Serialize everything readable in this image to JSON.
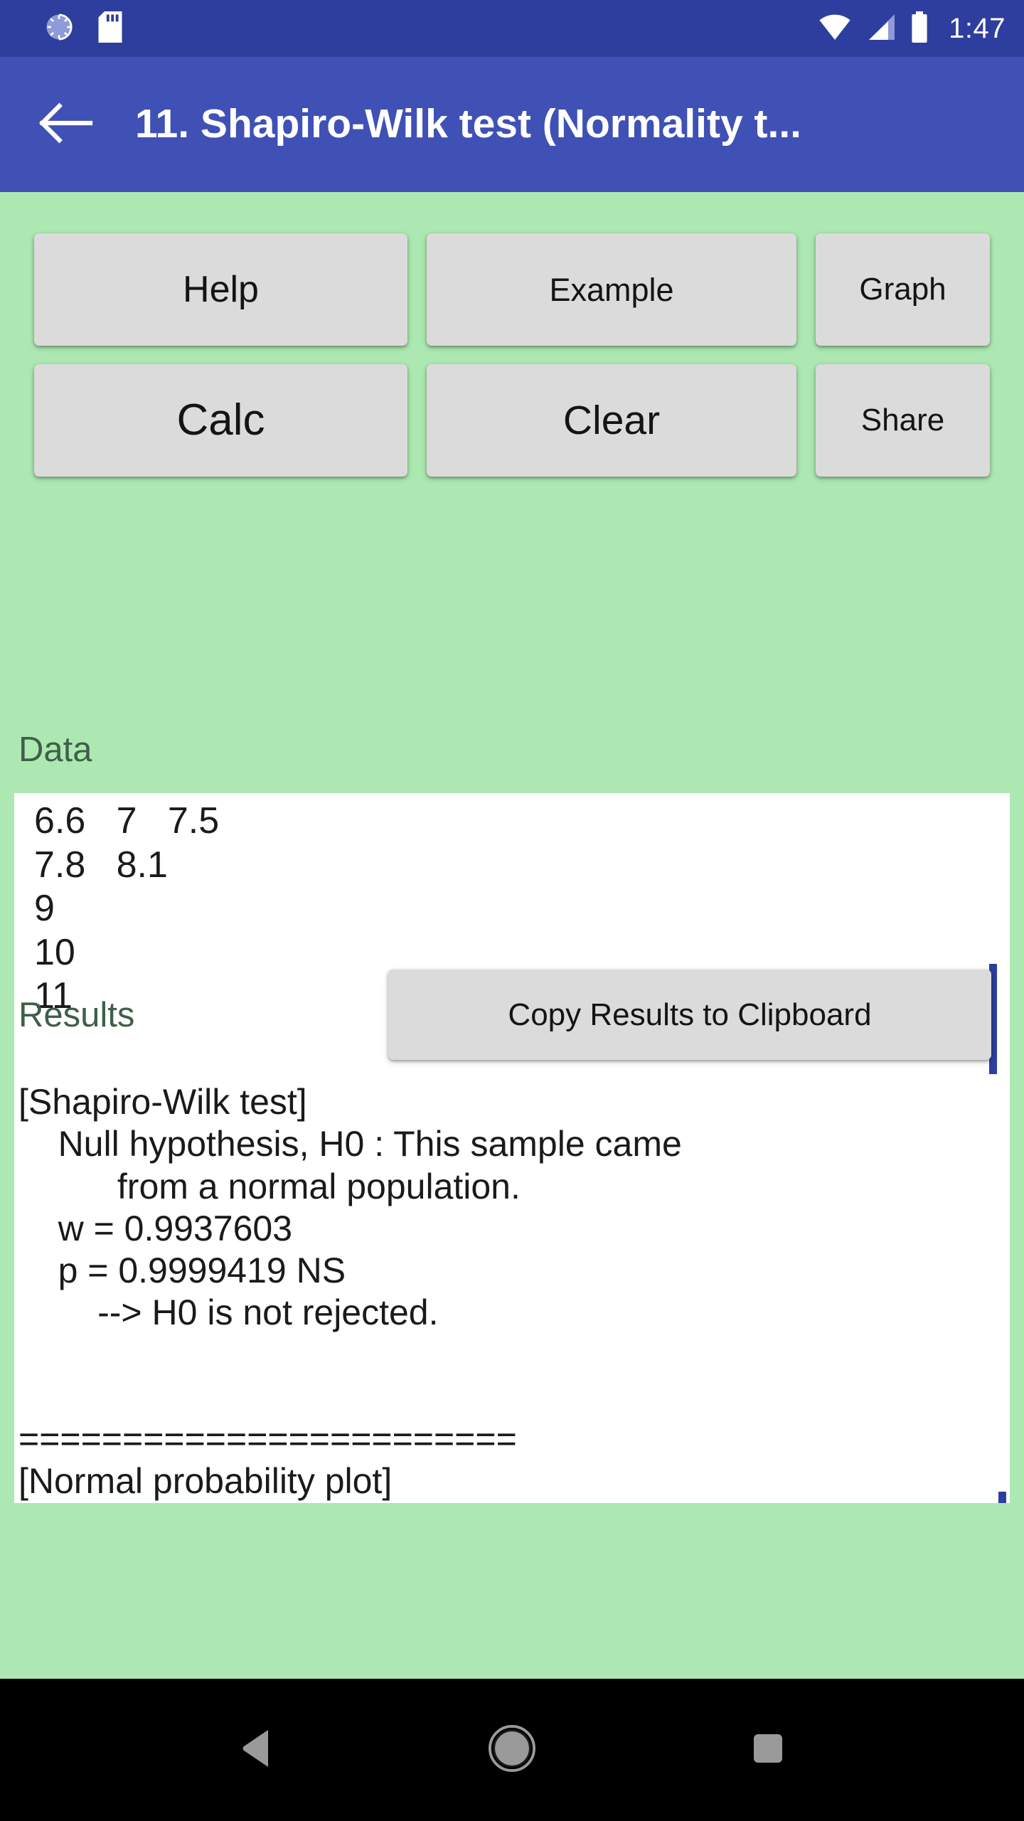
{
  "status_bar": {
    "time": "1:47",
    "icons": [
      "progress-spinner-icon",
      "sd-card-icon",
      "wifi-icon",
      "cellular-signal-icon",
      "battery-icon"
    ]
  },
  "app_bar": {
    "back_label": "back-arrow",
    "title": "11. Shapiro-Wilk test (Normality t..."
  },
  "toolbar": {
    "help_label": "Help",
    "example_label": "Example",
    "graph_label": "Graph",
    "calc_label": "Calc",
    "clear_label": "Clear",
    "share_label": "Share"
  },
  "data_section": {
    "label": "Data",
    "value": "6.6\t7\t7.5\n7.8\t8.1\n9\n10\n11\n",
    "display_value": "6.6   7   7.5\n7.8   8.1\n9\n10\n11"
  },
  "results_section": {
    "label": "Results",
    "copy_button_label": "Copy Results to Clipboard",
    "text": "[Shapiro-Wilk test]\n    Null hypothesis, H0 : This sample came\n          from a normal population.\n    w = 0.9937603\n    p = 0.9999419 NS\n        --> H0 is not rejected.\n\n\n========================\n[Normal probability plot]\n",
    "details": {
      "test_name": "[Shapiro-Wilk test]",
      "null_hypothesis_line1": "Null hypothesis, H0 : This sample came",
      "null_hypothesis_line2": "from a normal population.",
      "w_statistic": "w = 0.9937603",
      "p_value": "p = 0.9999419 NS",
      "conclusion": "--> H0 is not rejected.",
      "separator": "========================",
      "plot_heading": "[Normal probability plot]"
    }
  },
  "nav_bar": {
    "back_label": "back-triangle",
    "home_label": "home-circle",
    "recents_label": "recents-square"
  },
  "colors": {
    "status_bar": "#2E3E9E",
    "app_bar": "#3F51B5",
    "background": "#ADE8B2",
    "button_face": "#DBDBDB",
    "label_text": "#3F5F48",
    "scrollbar": "#2E3E9E",
    "caret": "#F0396B",
    "field_bg": "#FFFFFF",
    "nav_bar": "#000000"
  }
}
